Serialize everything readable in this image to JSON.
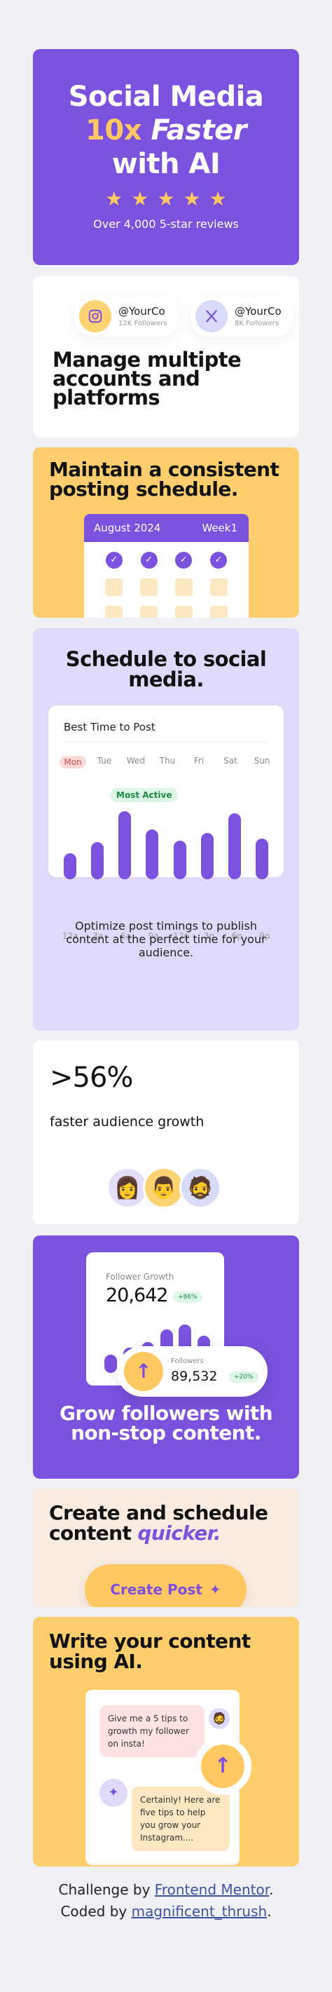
{
  "hero": {
    "line1": "Social Media",
    "line2_accent": "10x",
    "line2_rest": "Faster",
    "line3": "with AI",
    "star_icon": "star-icon",
    "star_count": 5,
    "reviews": "Over 4,000 5-star reviews"
  },
  "manage": {
    "accounts": [
      {
        "handle": "@YourCo",
        "followers": "12K Followers",
        "icon": "instagram-icon"
      },
      {
        "handle": "@YourCo",
        "followers": "8K Followers",
        "icon": "x-icon"
      }
    ],
    "title": "Manage multipte accounts and platforms"
  },
  "consistent": {
    "title": "Maintain a consistent posting schedule.",
    "month": "August 2024",
    "week": "Week1"
  },
  "social": {
    "title": "Schedule to social media.",
    "graph_title": "Best Time to Post",
    "days": [
      "Mon",
      "Tue",
      "Wed",
      "Thu",
      "Fri",
      "Sat",
      "Sun"
    ],
    "badge": "Most Active",
    "hours": [
      "12a",
      "3a",
      "6a",
      "9a",
      "12p",
      "3p",
      "6p",
      "9p"
    ],
    "activity_levels": [
      0.34,
      0.49,
      0.9,
      0.66,
      0.51,
      0.61,
      0.87,
      0.54
    ],
    "description": "Optimize post timings to publish content at the perfect time for your audience."
  },
  "growth": {
    "stat": ">56%",
    "label": "faster audience growth"
  },
  "followers": {
    "growth_label": "Follower Growth",
    "growth_value": "20,642",
    "growth_change": "+86%",
    "growth_levels": [
      0.32,
      0.45,
      0.55,
      0.78,
      0.86,
      0.66
    ],
    "followers_label": "Followers",
    "followers_value": "89,532",
    "followers_change": "+20%",
    "title": "Grow followers with non-stop content."
  },
  "create": {
    "title_plain": "Create and schedule content ",
    "title_accent": "quicker.",
    "button": "Create Post"
  },
  "write": {
    "title": "Write your content using AI.",
    "user_message": "Give me a 5 tips to growth my follower on insta!",
    "ai_message": "Certainly! Here are five tips to help you grow your Instagram...."
  },
  "footer": {
    "challenge_prefix": "Challenge by",
    "challenge_link": "Frontend Mentor",
    "coded_prefix": "Coded by",
    "coded_link": "magnificent_thrush",
    "period": "."
  }
}
